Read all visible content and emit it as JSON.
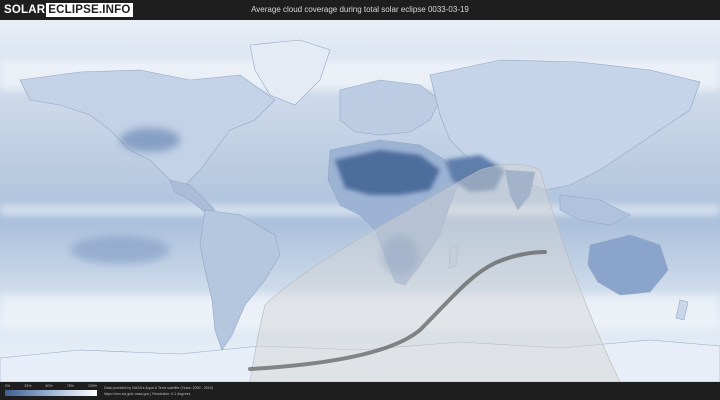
{
  "header": {
    "logo_part1": "SOLAR",
    "logo_part2": "ECLIPSE.INFO",
    "title": "Average cloud coverage during total solar eclipse 0033-03-19"
  },
  "legend": {
    "ticks": [
      "0%",
      "25%",
      "50%",
      "75%",
      "100%"
    ]
  },
  "footer": {
    "credit_line1": "Data provided by NASA's Aqua & Terra satellite (Years: 2000 - 2019)",
    "credit_line2": "https://neo.sci.gsfc.nasa.gov | Resolution: 0.1 degrees"
  },
  "colors": {
    "ocean_low_cloud": "#6e8fba",
    "cloud_high": "#f4f7fb",
    "land_dark": "#3f5f8f",
    "eclipse_path": "#5a5a5a",
    "penumbra_shade": "#cfcfcf"
  }
}
